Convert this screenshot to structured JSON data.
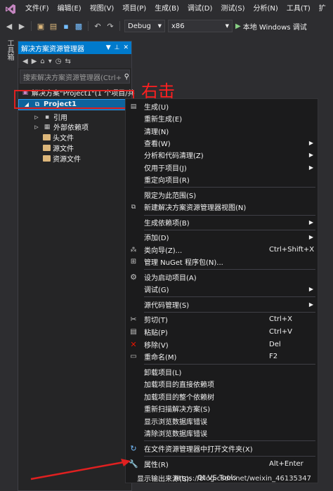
{
  "menubar": {
    "items": [
      "文件(F)",
      "编辑(E)",
      "视图(V)",
      "项目(P)",
      "生成(B)",
      "调试(D)",
      "测试(S)",
      "分析(N)",
      "工具(T)",
      "扩"
    ]
  },
  "toolbar": {
    "config": "Debug",
    "platform": "x86",
    "run_label": "本地 Windows 调试"
  },
  "toolbox_label": "工具箱",
  "solution_explorer": {
    "title": "解决方案资源管理器",
    "search_placeholder": "搜索解决方案资源管理器(Ctrl+",
    "tree": {
      "solution": "解决方案\"Project1\"(1 个项目/共",
      "project": "Project1",
      "references": "引用",
      "external_deps": "外部依赖项",
      "headers": "头文件",
      "sources": "源文件",
      "resources": "资源文件"
    }
  },
  "annotation": {
    "right_click_label": "右击"
  },
  "context_menu": {
    "build": "生成(U)",
    "rebuild": "重新生成(E)",
    "clean": "清理(N)",
    "view": "查看(W)",
    "analyze": "分析和代码清理(Z)",
    "project_only": "仅用于项目(J)",
    "retarget": "重定向项目(R)",
    "scope": "限定为此范围(S)",
    "new_view": "新建解决方案资源管理器视图(N)",
    "build_deps": "生成依赖项(B)",
    "add": "添加(D)",
    "class_wizard": "类向导(Z)...",
    "class_wizard_shortcut": "Ctrl+Shift+X",
    "nuget": "管理 NuGet 程序包(N)...",
    "startup": "设为启动项目(A)",
    "debug": "调试(G)",
    "source_control": "源代码管理(S)",
    "cut": "剪切(T)",
    "cut_shortcut": "Ctrl+X",
    "paste": "粘贴(P)",
    "paste_shortcut": "Ctrl+V",
    "remove": "移除(V)",
    "remove_shortcut": "Del",
    "rename": "重命名(M)",
    "rename_shortcut": "F2",
    "unload": "卸载项目(L)",
    "load_direct": "加载项目的直接依赖项",
    "load_tree": "加载项目的整个依赖树",
    "rescan": "重新扫描解决方案(S)",
    "show_browse_err": "显示浏览数据库错误",
    "clear_browse_err": "清除浏览数据库错误",
    "open_folder": "在文件资源管理器中打开文件夹(X)",
    "properties": "属性(R)",
    "properties_shortcut": "Alt+Enter"
  },
  "bottom": {
    "output_text": "显示输出来源(S):",
    "qt_text": "Qt VS Tools",
    "watermark": "https://blog.csdn.net/weixin_46135347"
  },
  "colors": {
    "accent": "#007acc",
    "annotation": "#e02020"
  }
}
